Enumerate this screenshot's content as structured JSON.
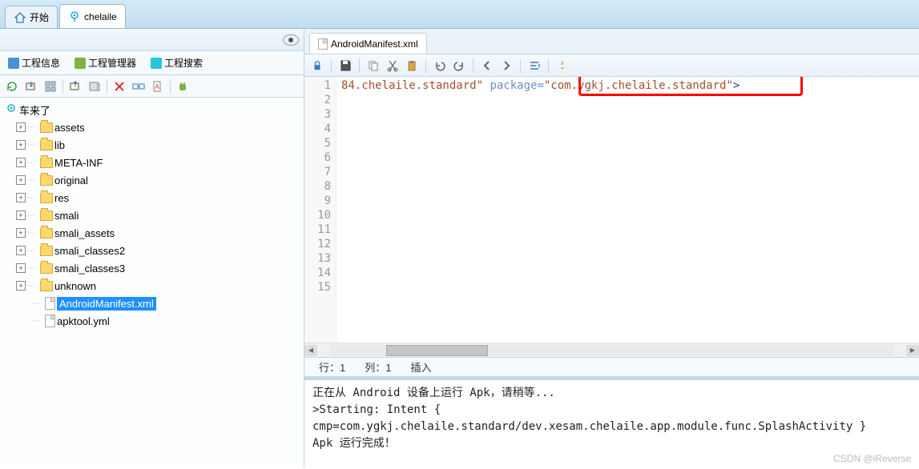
{
  "tabs": {
    "start": "开始",
    "project": "chelaile"
  },
  "subtabs": {
    "info": "工程信息",
    "manager": "工程管理器",
    "search": "工程搜索"
  },
  "tree": {
    "root": "车来了",
    "folders": [
      "assets",
      "lib",
      "META-INF",
      "original",
      "res",
      "smali",
      "smali_assets",
      "smali_classes2",
      "smali_classes3",
      "unknown"
    ],
    "files": [
      "AndroidManifest.xml",
      "apktool.yml"
    ],
    "selected": "AndroidManifest.xml"
  },
  "editor": {
    "file_tab": "AndroidManifest.xml",
    "line_count": 15,
    "code": {
      "seg1": "84.chelaile.standard\"",
      "seg2": " package=",
      "seg3": "\"com.ygkj.chelaile.standard\"",
      "seg4": ">"
    }
  },
  "status": {
    "row_label": "行：",
    "row_value": "1",
    "col_label": "列：",
    "col_value": "1",
    "mode": "插入"
  },
  "console_lines": [
    "正在从 Android 设备上运行 Apk，请稍等...",
    ">Starting: Intent { cmp=com.ygkj.chelaile.standard/dev.xesam.chelaile.app.module.func.SplashActivity }",
    "Apk 运行完成！"
  ],
  "watermark": "CSDN @iReverse"
}
